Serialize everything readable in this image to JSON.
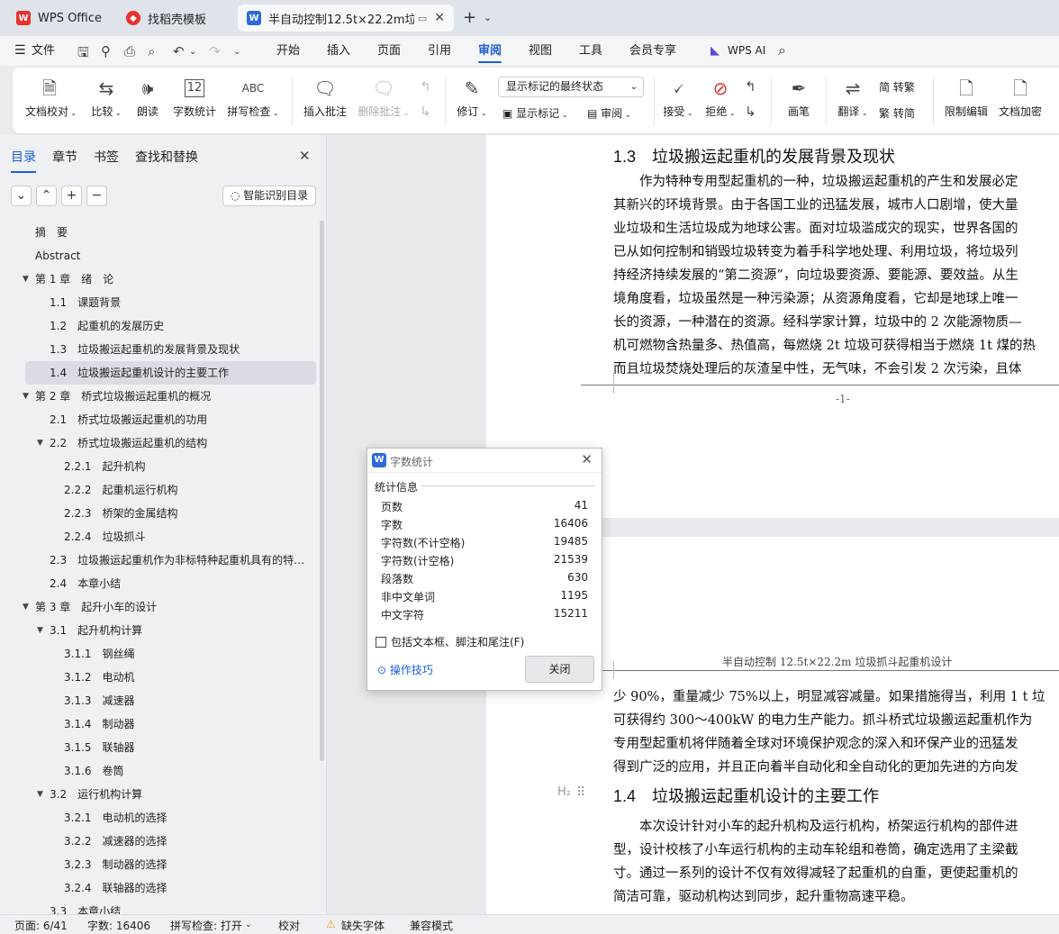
{
  "tabs": [
    {
      "label": "WPS Office",
      "icon": "wps-logo"
    },
    {
      "label": "找稻壳模板",
      "icon": "docer-logo"
    },
    {
      "label": "半自动控制12.5t×22.2m垃圾",
      "icon": "writer-logo"
    }
  ],
  "menu": {
    "file": "文件",
    "items": [
      "开始",
      "插入",
      "页面",
      "引用",
      "审阅",
      "视图",
      "工具",
      "会员专享"
    ],
    "active": "审阅",
    "ai": "WPS AI"
  },
  "ribbon": {
    "doc_check": "文档校对",
    "compare": "比较",
    "read_aloud": "朗读",
    "word_count": "字数统计",
    "spell_check": "拼写检查",
    "insert_comment": "插入批注",
    "delete_comment": "删除批注",
    "revise": "修订",
    "markup_dropdown": "显示标记的最终状态",
    "show_markup": "显示标记",
    "review": "审阅",
    "accept": "接受",
    "reject": "拒绝",
    "pen": "画笔",
    "translate": "翻译",
    "simp_to_trad": "简 转繁",
    "trad_to_simp": "繁 转简",
    "restrict_edit": "限制编辑",
    "doc_encrypt": "文档加密",
    "wc_icon_text": "12",
    "spell_icon_text": "ABC"
  },
  "sidebar": {
    "tabs": [
      "目录",
      "章节",
      "书签",
      "查找和替换"
    ],
    "smart_button": "智能识别目录",
    "toc": [
      {
        "label": "摘　要",
        "level": 0,
        "arrow": false
      },
      {
        "label": "Abstract",
        "level": 0,
        "arrow": false
      },
      {
        "label": "第 1 章　绪　论",
        "level": 0,
        "arrow": true
      },
      {
        "label": "1.1　课题背景",
        "level": 1,
        "arrow": false
      },
      {
        "label": "1.2　起重机的发展历史",
        "level": 1,
        "arrow": false
      },
      {
        "label": "1.3　垃圾搬运起重机的发展背景及现状",
        "level": 1,
        "arrow": false
      },
      {
        "label": "1.4　垃圾搬运起重机设计的主要工作",
        "level": 1,
        "arrow": false,
        "selected": true
      },
      {
        "label": "第 2 章　桥式垃圾搬运起重机的概况",
        "level": 0,
        "arrow": true
      },
      {
        "label": "2.1　桥式垃圾搬运起重机的功用",
        "level": 1,
        "arrow": false
      },
      {
        "label": "2.2　桥式垃圾搬运起重机的结构",
        "level": 1,
        "arrow": true
      },
      {
        "label": "2.2.1　起升机构",
        "level": 2,
        "arrow": false
      },
      {
        "label": "2.2.2　起重机运行机构",
        "level": 2,
        "arrow": false
      },
      {
        "label": "2.2.3　桥架的金属结构",
        "level": 2,
        "arrow": false
      },
      {
        "label": "2.2.4　垃圾抓斗",
        "level": 2,
        "arrow": false
      },
      {
        "label": "2.3　垃圾搬运起重机作为非标特种起重机具有的特 ...",
        "level": 1,
        "arrow": false
      },
      {
        "label": "2.4　本章小结",
        "level": 1,
        "arrow": false
      },
      {
        "label": "第 3 章　起升小车的设计",
        "level": 0,
        "arrow": true
      },
      {
        "label": "3.1　起升机构计算",
        "level": 1,
        "arrow": true
      },
      {
        "label": "3.1.1　钢丝绳",
        "level": 2,
        "arrow": false
      },
      {
        "label": "3.1.2　电动机",
        "level": 2,
        "arrow": false
      },
      {
        "label": "3.1.3　减速器",
        "level": 2,
        "arrow": false
      },
      {
        "label": "3.1.4　制动器",
        "level": 2,
        "arrow": false
      },
      {
        "label": "3.1.5　联轴器",
        "level": 2,
        "arrow": false
      },
      {
        "label": "3.1.6　卷筒",
        "level": 2,
        "arrow": false
      },
      {
        "label": "3.2　运行机构计算",
        "level": 1,
        "arrow": true
      },
      {
        "label": "3.2.1　电动机的选择",
        "level": 2,
        "arrow": false
      },
      {
        "label": "3.2.2　减速器的选择",
        "level": 2,
        "arrow": false
      },
      {
        "label": "3.2.3　制动器的选择",
        "level": 2,
        "arrow": false
      },
      {
        "label": "3.2.4　联轴器的选择",
        "level": 2,
        "arrow": false
      },
      {
        "label": "3.3　本章小结",
        "level": 1,
        "arrow": false
      }
    ]
  },
  "document": {
    "heading1": "1.3　垃圾搬运起重机的发展背景及现状",
    "para1": [
      "　　作为特种专用型起重机的一种，垃圾搬运起重机的产生和发展必定",
      "其新兴的环境背景。由于各国工业的迅猛发展，城市人口剧增，使大量",
      "业垃圾和生活垃圾成为地球公害。面对垃圾滥成灾的现实，世界各国的",
      "已从如何控制和销毁垃圾转变为着手科学地处理、利用垃圾，将垃圾列",
      "持经济持续发展的“第二资源”，向垃圾要资源、要能源、要效益。从生",
      "境角度看，垃圾虽然是一种污染源；从资源角度看，它却是地球上唯一",
      "长的资源，一种潜在的资源。经科学家计算，垃圾中的 2 次能源物质—",
      "机可燃物含热量多、热值高，每燃烧 2t 垃圾可获得相当于燃烧 1t 煤的热",
      "而且垃圾焚烧处理后的灰渣呈中性，无气味，不会引发 2 次污染，且体"
    ],
    "page_number": "-1-",
    "header": "半自动控制 12.5t×22.2m 垃圾抓斗起重机设计",
    "para2": [
      "少 90%，重量减少 75%以上，明显减容减量。如果措施得当，利用 1 t 垃",
      "可获得约 300～400kW 的电力生产能力。抓斗桥式垃圾搬运起重机作为",
      "专用型起重机将伴随着全球对环境保护观念的深入和环保产业的迅猛发",
      "得到广泛的应用，并且正向着半自动化和全自动化的更加先进的方向发"
    ],
    "h2_marker": "H₂",
    "heading2": "1.4　垃圾搬运起重机设计的主要工作",
    "para3": [
      "　　本次设计针对小车的起升机构及运行机构，桥架运行机构的部件进",
      "型，设计校核了小车运行机构的主动车轮组和卷筒，确定选用了主梁截",
      "寸。通过一系列的设计不仅有效得减轻了起重机的自重，更使起重机的",
      "简洁可靠，驱动机构达到同步，起升重物高速平稳。"
    ]
  },
  "dialog": {
    "title": "字数统计",
    "section": "统计信息",
    "rows": [
      {
        "label": "页数",
        "value": "41"
      },
      {
        "label": "字数",
        "value": "16406"
      },
      {
        "label": "字符数(不计空格)",
        "value": "19485"
      },
      {
        "label": "字符数(计空格)",
        "value": "21539"
      },
      {
        "label": "段落数",
        "value": "630"
      },
      {
        "label": "非中文单词",
        "value": "1195"
      },
      {
        "label": "中文字符",
        "value": "15211"
      }
    ],
    "checkbox": "包括文本框、脚注和尾注(F)",
    "tips": "操作技巧",
    "close": "关闭"
  },
  "status": {
    "page": "页面: 6/41",
    "words": "字数: 16406",
    "spell": "拼写检查: 打开",
    "proof": "校对",
    "missing_font": "缺失字体",
    "compat": "兼容模式"
  },
  "colors": {
    "accent": "#1b5fd6",
    "wps_red": "#e8322e",
    "writer_blue": "#2b6bd9",
    "warning": "#f0a020"
  }
}
